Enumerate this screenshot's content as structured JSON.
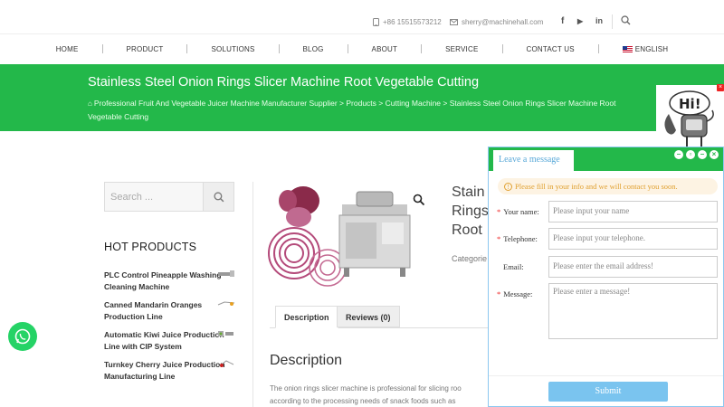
{
  "topbar": {
    "phone": "+86 15515573212",
    "email": "sherry@machinehall.com",
    "social": [
      "f",
      "▶",
      "in"
    ]
  },
  "nav": {
    "items": [
      "HOME",
      "PRODUCT",
      "SOLUTIONS",
      "BLOG",
      "ABOUT",
      "SERVICE",
      "CONTACT US"
    ],
    "language": "ENGLISH"
  },
  "hero": {
    "title": "Stainless Steel Onion Rings Slicer Machine Root Vegetable Cutting",
    "breadcrumb": "Professional Fruit And Vegetable Juicer Machine Manufacturer Supplier > Products > Cutting Machine > Stainless Steel Onion Rings Slicer Machine Root Vegetable Cutting"
  },
  "mascot": {
    "text": "Hi!"
  },
  "sidebar": {
    "search_placeholder": "Search ...",
    "hot_title": "HOT PRODUCTS",
    "hot_products": [
      "PLC Control Pineapple Washing Cleaning Machine",
      "Canned Mandarin Oranges Production Line",
      "Automatic Kiwi Juice Production Line with CIP System",
      "Turnkey Cherry Juice Production Manufacturing Line"
    ]
  },
  "product": {
    "title_partial": "Stain Rings Root",
    "category_partial": "Categorie",
    "tabs": [
      "Description",
      "Reviews (0)"
    ],
    "description_heading": "Description",
    "description_text_1": "The onion rings slicer machine is professional for slicing roo",
    "description_text_2": "according to the processing needs of snack foods such as"
  },
  "chat": {
    "tab_label": "Leave a message",
    "notice": "Please fill in your info and we will contact you soon.",
    "fields": [
      {
        "label": "Your name:",
        "required": true,
        "placeholder": "Please input your name"
      },
      {
        "label": "Telephone:",
        "required": true,
        "placeholder": "Please input your telephone."
      },
      {
        "label": "Email:",
        "required": false,
        "placeholder": "Please enter the email address!"
      },
      {
        "label": "Message:",
        "required": true,
        "placeholder": "Please enter a message!"
      }
    ],
    "submit_label": "Submit",
    "required_mark": "*"
  },
  "colors": {
    "brand_green": "#23b84a",
    "chat_blue": "#7ac4ef",
    "whatsapp": "#25d366"
  }
}
